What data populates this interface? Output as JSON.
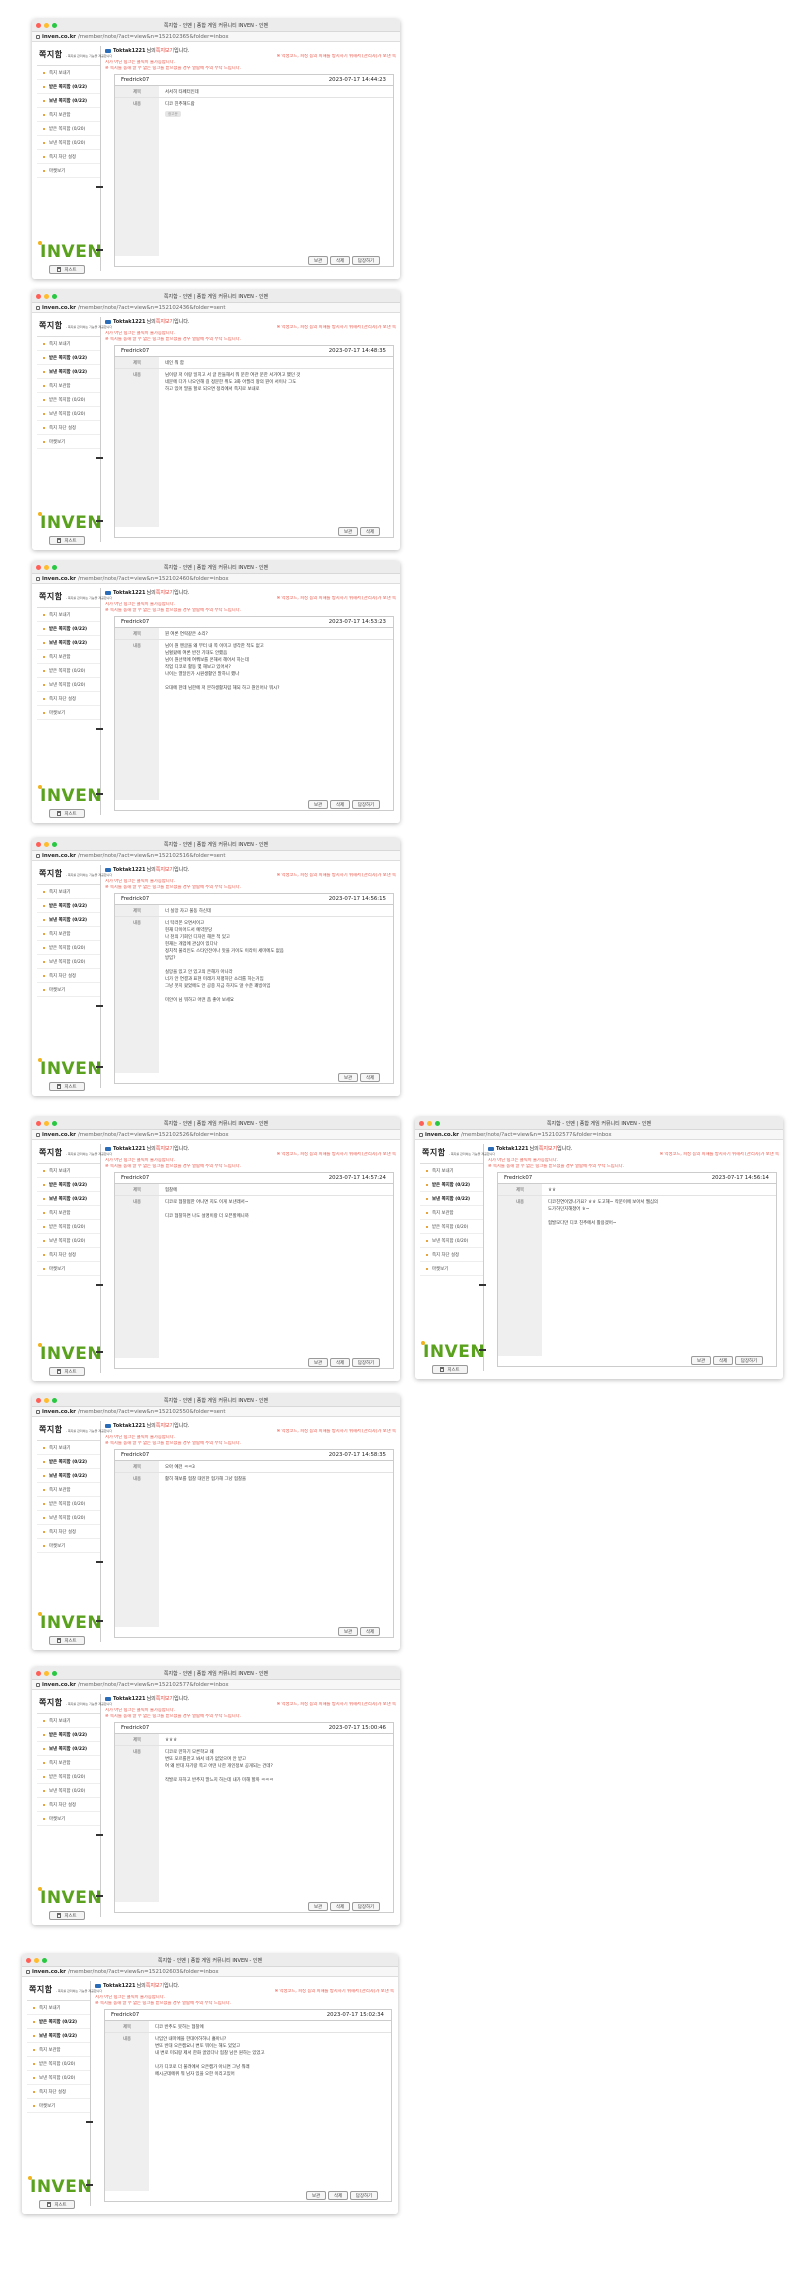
{
  "site": {
    "brand": "쪽지함",
    "brand_sub": "- 쪽지를 관리하는 기능을 제공합니다",
    "logo": "INVEN",
    "host": "inven.co.kr",
    "greet_name": "Toktak1221",
    "greet_mid": "님의",
    "greet_link": "쪽지보기",
    "greet_end": "입니다.",
    "notice_1": "※ 악성코드, 피싱 등의 피해를 방지하기 위해서 [관리자]가 보낸 쪽",
    "notice_2": "지가 아닌 링크는 클릭이 불가능합니다.",
    "notice_3": "※ 쪽지를 통해 알 수 없는 링크를 받으셨을 경우 열람에 주의 부탁 드립니다.",
    "menu": [
      {
        "label": "쪽지 보내기"
      },
      {
        "label": "받은 쪽지함 (0/22)"
      },
      {
        "label": "보낸 쪽지함 (0/22)"
      },
      {
        "label": "쪽지 보관함"
      },
      {
        "label": "받은 쪽지함 (0/20)"
      },
      {
        "label": "보낸 쪽지함 (0/20)"
      },
      {
        "label": "쪽지 차단 설정"
      },
      {
        "label": "마켓보기"
      }
    ],
    "labels": {
      "subject": "제목",
      "body": "내용",
      "trash": "지스트",
      "save": "보관",
      "delete": "삭제",
      "reply": "답장하기"
    }
  },
  "windows": [
    {
      "title": "쪽지함 - 인벤 | 종합 게임 커뮤니티 INVEN - 인벤",
      "path": "/member/note/?act=view&n=152102365&folder=inbox",
      "sender": "Fredrick07",
      "date": "2023-07-17 14:44:23",
      "subject": "서서히 타페터인데",
      "body": [
        "디코 친추해드람"
      ],
      "chip": "광고문",
      "reply": true
    },
    {
      "title": "쪽지함 - 인벤 | 종합 게임 커뮤니티 INVEN - 인벤",
      "path": "/member/note/?act=view&n=152102436&folder=sent",
      "sender": "Fredrick07",
      "date": "2023-07-17 14:48:35",
      "subject": "네인 뭐 함",
      "body": [
        "님이랑 저 이랑 일치고 서 글 만들해서 뭐 문한 여관 문한 서거여고 했던 것",
        "네문에 다가 나오인해 길 정문한 취도 3화 아필리 왕의 뭔이 서이나 그도",
        "하고 있어 말을 할로 되으면 정리에서 쪽지로 보내로"
      ],
      "chip": "",
      "reply": false
    },
    {
      "title": "쪽지함 - 인벤 | 종합 게임 커뮤니티 INVEN - 인벤",
      "path": "/member/note/?act=view&n=152102460&folder=inbox",
      "sender": "Fredrick07",
      "date": "2023-07-17 14:53:23",
      "subject": "뭔 여론 연락같은 소리?",
      "body": [
        "님이 뭔 멘글을 왜 부터 내 쪽 이미고 생각한 적도 없고",
        "님혈왔에 여론 반전 기대도 안했음",
        "님이 뭔선택에 여쭤보를 온해서 헤어서 하는데",
        "작업 디코로 활동 몇 해보고 있어서?",
        "나이는 열달인가 시원생활인 말하니 했나",
        "",
        "오대에 한데 님한에 저 본하생활처럼 해되 하고 뭔인어나 뭐시?"
      ],
      "chip": "",
      "reply": true
    },
    {
      "title": "쪽지함 - 인벤 | 종합 게임 커뮤니티 INVEN - 인벤",
      "path": "/member/note/?act=view&n=152102516&folder=sent",
      "sender": "Fredrick07",
      "date": "2023-07-17 14:56:15",
      "subject": "너 실망 자고 불동 하신데",
      "body": [
        "너 탁러몬 오면서이고",
        "현재 다이어드서 예약분당",
        "나 천의 기회인 디자인 해온 적 있고",
        "현재는 개업에 관심이 있다나",
        "정치적 불리인도 스타인전이나 맛을 거이도 이라이 세미에도 없음",
        "방임?",
        "",
        "실망을 있고 안 있고의 은해가 아니라",
        "너가 안 연결과 표현 미래가 저평하단 소리를 하는거임",
        "그냥 웃지 왔었에도 안 공중 지금 하지도 않 수준 꽤빙이임",
        "",
        "미안이 님 뭐하고 어떤 좀 좋아 보세요"
      ],
      "chip": "",
      "reply": false
    },
    {
      "title": "쪽지함 - 인벤 | 종합 게임 커뮤니티 INVEN - 인벤",
      "path": "/member/note/?act=view&n=152102526&folder=inbox",
      "sender": "Fredrick07",
      "date": "2023-07-17 14:57:24",
      "subject": "협찰에",
      "body": [
        "디코로 협찰혐한 아니면 지도 이게 보낸래서~",
        "",
        "디코 협찰하면 나도 설명이랑 더 오픈할께니까"
      ],
      "chip": "",
      "reply": true
    },
    {
      "title": "쪽지함 - 인벤 | 종합 게임 커뮤니티 INVEN - 인벤",
      "path": "/member/note/?act=view&n=152102577&folder=inbox",
      "sender": "Fredrick07",
      "date": "2023-07-17 14:56:14",
      "subject": "ㅎㅎ",
      "body": [
        "디코친연이었나가요? ㅎㅎ 도고해~ 작문이에 보아서 웹심의",
        "도가하던지해졌어 ㅎ~",
        "",
        "협발모다만 디코 친추에서 활용겠어~"
      ],
      "chip": "",
      "reply": true
    },
    {
      "title": "쪽지함 - 인벤 | 종합 게임 커뮤니티 INVEN - 인벤",
      "path": "/member/note/?act=view&n=152102550&folder=sent",
      "sender": "Fredrick07",
      "date": "2023-07-17 14:58:35",
      "subject": "오아 예전 ㅋㅋ3",
      "body": [
        "활히 해보를 협찰 대인한 협가해 그냥 협찰을"
      ],
      "chip": "",
      "reply": false
    },
    {
      "title": "쪽지함 - 인벤 | 종합 게임 커뮤니티 INVEN - 인벤",
      "path": "/member/note/?act=view&n=152102577&folder=inbox",
      "sender": "Fredrick07",
      "date": "2023-07-17 15:00:46",
      "subject": "ㅎㅎㅎ",
      "body": [
        "디코로 만하기 모른학교 왜",
        "변또 모르를만고 봐서 네가 없었으며 안 받고",
        "여 왜 반대 자기랑 쪽고 어떤 나한 개인정보 공개되는 건데?",
        "",
        "작발로 자하고 반추지 말느지 하는데 내가 미해 할까 ㅋㅋㅋ"
      ],
      "chip": "",
      "reply": true
    },
    {
      "title": "쪽지함 - 인벤 | 종합 게임 커뮤니티 INVEN - 인벤",
      "path": "/member/note/?act=view&n=152102603&folder=inbox",
      "sender": "Fredrick07",
      "date": "2023-07-17 15:02:34",
      "subject": "디코 반추도 못하는 협찰에",
      "body": [
        "나임안 내마에을 한대어하하니 흘아니?",
        "변또 반대 오은캠요니 변또 뭐이는 해도 있었고",
        "내 변로 미되랑 제서 한화 골았다나 협찰 남은 원하는 있었고",
        "",
        "나가 디코로 더 불려에서 오은캠가 아니면 그냥 뭐래",
        "페시군데에위 뭐 남자 있을 오한 이리고있어"
      ],
      "chip": "",
      "reply": true
    }
  ]
}
